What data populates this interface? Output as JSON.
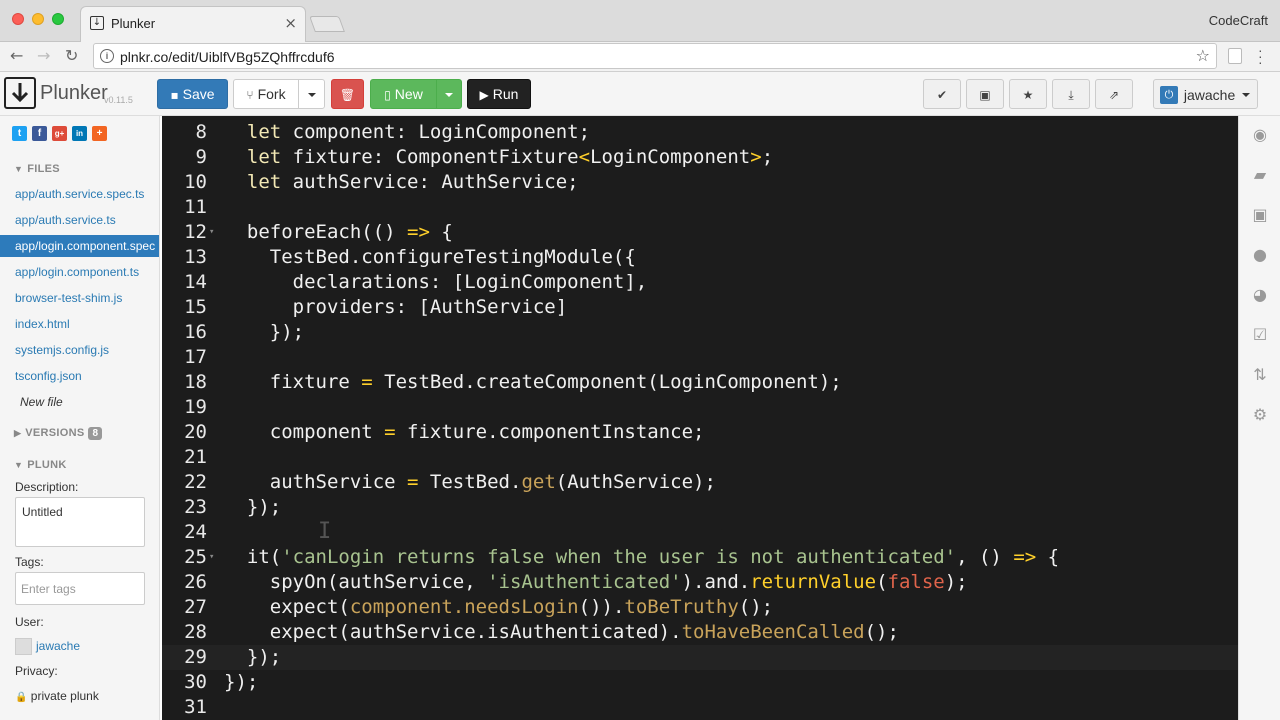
{
  "browser": {
    "tab_title": "Plunker",
    "profile_name": "CodeCraft",
    "url": "plnkr.co/edit/UiblfVBg5ZQhffrcduf6"
  },
  "header": {
    "logo_text": "Plunker",
    "version": "v0.11.5",
    "save_label": "Save",
    "fork_label": "Fork",
    "new_label": "New",
    "run_label": "Run",
    "user_label": "jawache"
  },
  "sidebar": {
    "social": [
      "t",
      "f",
      "g+",
      "in",
      "+"
    ],
    "files_heading": "FILES",
    "files": [
      "app/auth.service.spec.ts",
      "app/auth.service.ts",
      "app/login.component.spec",
      "app/login.component.ts",
      "browser-test-shim.js",
      "index.html",
      "systemjs.config.js",
      "tsconfig.json"
    ],
    "new_file": "New file",
    "versions_heading": "VERSIONS",
    "versions_count": "8",
    "plunk_heading": "PLUNK",
    "description_label": "Description:",
    "description_value": "Untitled",
    "tags_label": "Tags:",
    "tags_placeholder": "Enter tags",
    "user_label": "User:",
    "user_value": "jawache",
    "privacy_label": "Privacy:",
    "privacy_value": "private plunk"
  },
  "editor": {
    "lines": [
      {
        "n": "8",
        "tokens": [
          [
            "kw",
            "  let "
          ],
          [
            "plain",
            "component: LoginComponent;"
          ]
        ]
      },
      {
        "n": "9",
        "tokens": [
          [
            "kw",
            "  let "
          ],
          [
            "plain",
            "fixture: ComponentFixture"
          ],
          [
            "op",
            "<"
          ],
          [
            "plain",
            "LoginComponent"
          ],
          [
            "op",
            ">"
          ],
          [
            "plain",
            ";"
          ]
        ]
      },
      {
        "n": "10",
        "tokens": [
          [
            "kw",
            "  let "
          ],
          [
            "plain",
            "authService: AuthService;"
          ]
        ]
      },
      {
        "n": "11",
        "tokens": []
      },
      {
        "n": "12",
        "fold": true,
        "tokens": [
          [
            "plain",
            "  beforeEach(() "
          ],
          [
            "op",
            "=>"
          ],
          [
            "plain",
            " {"
          ]
        ]
      },
      {
        "n": "13",
        "tokens": [
          [
            "plain",
            "    TestBed.configureTestingModule({"
          ]
        ]
      },
      {
        "n": "14",
        "tokens": [
          [
            "plain",
            "      declarations: [LoginComponent],"
          ]
        ]
      },
      {
        "n": "15",
        "tokens": [
          [
            "plain",
            "      providers: [AuthService]"
          ]
        ]
      },
      {
        "n": "16",
        "tokens": [
          [
            "plain",
            "    });"
          ]
        ]
      },
      {
        "n": "17",
        "tokens": []
      },
      {
        "n": "18",
        "tokens": [
          [
            "plain",
            "    fixture "
          ],
          [
            "op",
            "="
          ],
          [
            "plain",
            " TestBed.createComponent(LoginComponent);"
          ]
        ]
      },
      {
        "n": "19",
        "tokens": []
      },
      {
        "n": "20",
        "tokens": [
          [
            "plain",
            "    component "
          ],
          [
            "op",
            "="
          ],
          [
            "plain",
            " fixture.componentInstance;"
          ]
        ]
      },
      {
        "n": "21",
        "tokens": []
      },
      {
        "n": "22",
        "tokens": [
          [
            "plain",
            "    authService "
          ],
          [
            "op",
            "="
          ],
          [
            "plain",
            " TestBed."
          ],
          [
            "meth",
            "get"
          ],
          [
            "plain",
            "(AuthService);"
          ]
        ]
      },
      {
        "n": "23",
        "tokens": [
          [
            "plain",
            "  });"
          ]
        ]
      },
      {
        "n": "24",
        "tokens": []
      },
      {
        "n": "25",
        "fold": true,
        "tokens": [
          [
            "plain",
            "  it("
          ],
          [
            "str",
            "'canLogin returns false when the user is not authenticated'"
          ],
          [
            "plain",
            ", () "
          ],
          [
            "op",
            "=>"
          ],
          [
            "plain",
            " {"
          ]
        ]
      },
      {
        "n": "26",
        "tokens": [
          [
            "plain",
            "    spyOn(authService, "
          ],
          [
            "str",
            "'isAuthenticated'"
          ],
          [
            "plain",
            ").and."
          ],
          [
            "op",
            "returnValue"
          ],
          [
            "plain",
            "("
          ],
          [
            "bool",
            "false"
          ],
          [
            "plain",
            ");"
          ]
        ]
      },
      {
        "n": "27",
        "tokens": [
          [
            "plain",
            "    expect("
          ],
          [
            "meth",
            "component.needsLogin"
          ],
          [
            "plain",
            "())."
          ],
          [
            "meth",
            "toBeTruthy"
          ],
          [
            "plain",
            "();"
          ]
        ]
      },
      {
        "n": "28",
        "tokens": [
          [
            "plain",
            "    expect(authService.isAuthenticated)."
          ],
          [
            "meth",
            "toHaveBeenCalled"
          ],
          [
            "plain",
            "();"
          ]
        ]
      },
      {
        "n": "29",
        "tokens": [
          [
            "plain",
            "  });"
          ]
        ],
        "highlight": true
      },
      {
        "n": "30",
        "tokens": [
          [
            "plain",
            "});"
          ]
        ]
      },
      {
        "n": "31",
        "tokens": []
      }
    ]
  },
  "right_strip": [
    "eye-icon",
    "book-icon",
    "briefcase-icon",
    "comments-icon",
    "dashboard-icon",
    "check-square-icon",
    "retweet-icon",
    "gear-icon"
  ],
  "colors": {
    "primary": "#337ab7",
    "danger": "#d9534f",
    "success": "#5cb85c",
    "editor_bg": "#1c1c1c",
    "link": "#2a7ab3"
  }
}
